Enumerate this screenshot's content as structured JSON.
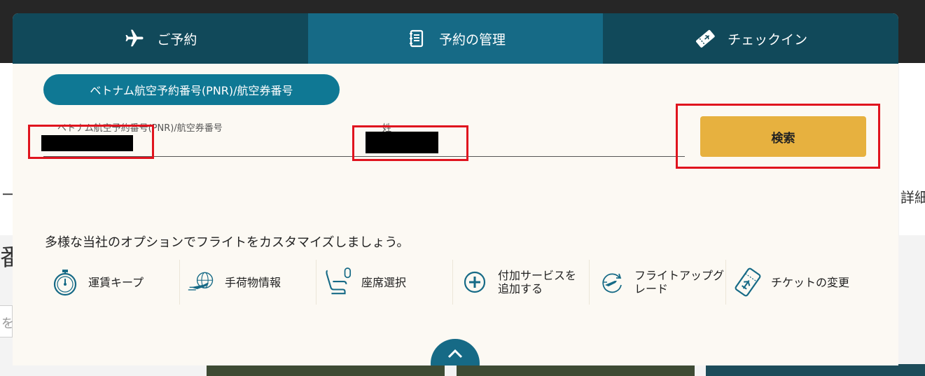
{
  "tabs": [
    {
      "label": "ご予約",
      "icon": "airplane-icon",
      "active": false
    },
    {
      "label": "予約の管理",
      "icon": "booklet-icon",
      "active": true
    },
    {
      "label": "チェックイン",
      "icon": "ticket-icon",
      "active": false
    }
  ],
  "lookup": {
    "mode_label": "ベトナム航空予約番号(PNR)/航空券番号",
    "pnr_label": "ベトナム航空予約番号(PNR)/航空券番号",
    "surname_label": "姓",
    "search_label": "検索"
  },
  "options": {
    "title": "多様な当社のオプションでフライトをカスタマイズしましょう。",
    "items": [
      {
        "label": "運賃キープ",
        "icon": "stopwatch-icon"
      },
      {
        "label": "手荷物情報",
        "icon": "airplane-globe-icon"
      },
      {
        "label": "座席選択",
        "icon": "seat-icon"
      },
      {
        "label": "付加サービスを\n追加する",
        "icon": "plus-circle-icon"
      },
      {
        "label": "フライトアップグ\nレード",
        "icon": "upgrade-plane-icon"
      },
      {
        "label": "チケットの変更",
        "icon": "ticket-change-icon"
      }
    ]
  },
  "background": {
    "left_text_1": "ー",
    "left_text_2": "番",
    "left_text_3": "を",
    "right_text": "詳細は"
  },
  "colors": {
    "tab_bar": "#11495a",
    "tab_active": "#166a86",
    "pill": "#0f7894",
    "search_button": "#e7b13f",
    "modal_bg": "#fcf9f3",
    "icon": "#166a86",
    "highlight": "#e0141e"
  }
}
